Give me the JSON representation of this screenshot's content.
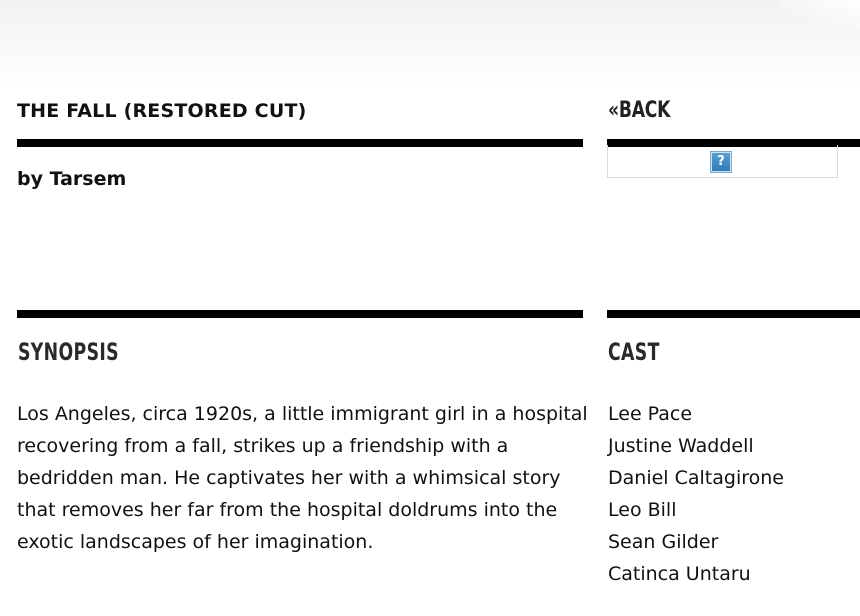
{
  "film": {
    "title": "THE FALL (RESTORED CUT)",
    "director_line": "by Tarsem"
  },
  "navigation": {
    "back_label": "«BACK"
  },
  "image_placeholder": {
    "icon": "missing-image-question-icon",
    "glyph": "?"
  },
  "synopsis": {
    "heading": "SYNOPSIS",
    "text": "Los Angeles, circa 1920s, a little immigrant girl in a hospital recovering from a fall, strikes up a friendship with a bedridden man. He captivates her with a whimsical story that removes her far from the hospital doldrums into the exotic landscapes of her imagination."
  },
  "cast": {
    "heading": "CAST",
    "members": [
      "Lee Pace",
      "Justine Waddell",
      "Daniel Caltagirone",
      "Leo Bill",
      "Sean Gilder",
      "Catinca Untaru"
    ]
  },
  "colors": {
    "rule": "#000000",
    "text": "#111111",
    "icon_blue": "#2f78b4"
  }
}
